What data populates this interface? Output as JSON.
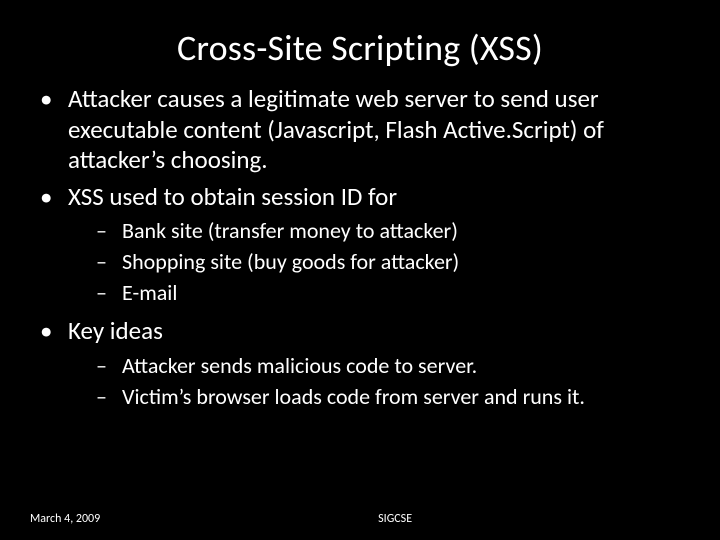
{
  "title": "Cross-Site Scripting (XSS)",
  "bullets": [
    {
      "text": "Attacker causes a legitimate web server to send user executable content (Javascript, Flash Active.Script) of attacker’s choosing."
    },
    {
      "text": "XSS used to obtain session ID for",
      "sub": [
        "Bank site (transfer money to attacker)",
        "Shopping site (buy goods for attacker)",
        "E-mail"
      ]
    },
    {
      "text": "Key ideas",
      "sub": [
        "Attacker sends malicious code to server.",
        "Victim’s browser loads code from server and runs it."
      ]
    }
  ],
  "footer": {
    "date": "March 4, 2009",
    "center": "SIGCSE"
  }
}
